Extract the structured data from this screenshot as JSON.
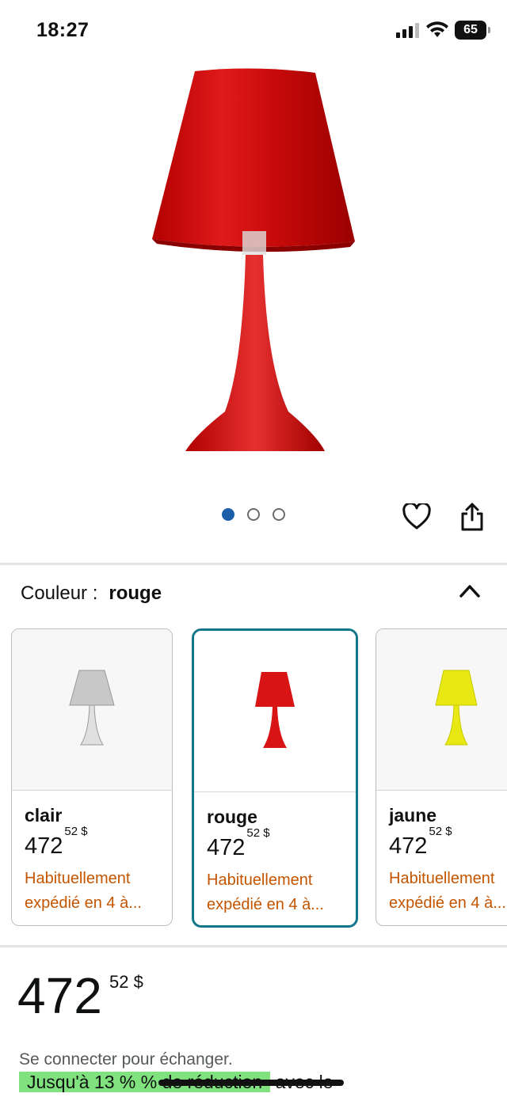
{
  "status_bar": {
    "time": "18:27",
    "battery": "65"
  },
  "gallery": {
    "image_count": 3,
    "active_index": 0
  },
  "color": {
    "label": "Couleur :",
    "selected": "rouge"
  },
  "variants": [
    {
      "name": "clair",
      "price_whole": "472",
      "price_cents": "52 $",
      "shipping_line1": "Habituellement",
      "shipping_line2": "expédié en 4 à...",
      "color": "#c8c8c8",
      "selected": false
    },
    {
      "name": "rouge",
      "price_whole": "472",
      "price_cents": "52 $",
      "shipping_line1": "Habituellement",
      "shipping_line2": "expédié en 4 à...",
      "color": "#d81414",
      "selected": true
    },
    {
      "name": "jaune",
      "price_whole": "472",
      "price_cents": "52 $",
      "shipping_line1": "Habituellement",
      "shipping_line2": "expédié en 4 à...",
      "color": "#e8e812",
      "selected": false
    }
  ],
  "price": {
    "whole": "472",
    "cents": "52 $"
  },
  "signin_text": "Se connecter pour échanger.",
  "promo": {
    "highlight": "Jusqu'à 13 % % de réduction",
    "rest": "avec le"
  },
  "colors": {
    "accent_border": "#117788",
    "shipping": "#c45500",
    "dot_active": "#1a5fa8",
    "promo_bg": "#7fe27f"
  }
}
